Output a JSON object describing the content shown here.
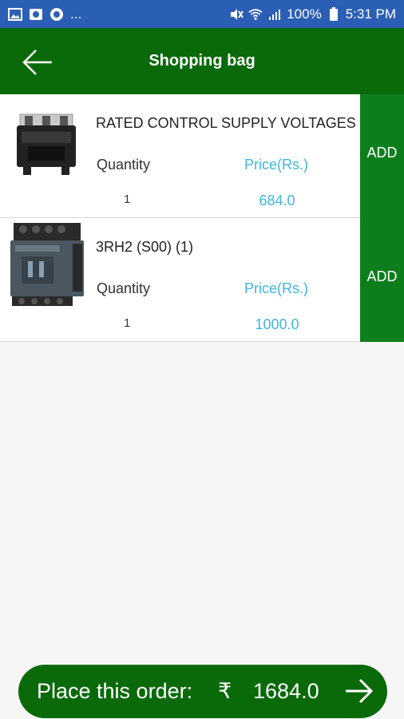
{
  "status_bar": {
    "left_ellipsis": "...",
    "battery": "100%",
    "time": "5:31 PM"
  },
  "app_bar": {
    "title": "Shopping bag"
  },
  "items": [
    {
      "name": "RATED CONTROL SUPPLY VOLTAGES",
      "quantity_label": "Quantity",
      "price_label": "Price(Rs.)",
      "quantity": "1",
      "price": "684.0",
      "add_label": "ADD"
    },
    {
      "name": "3RH2 (S00) (1)",
      "quantity_label": "Quantity",
      "price_label": "Price(Rs.)",
      "quantity": "1",
      "price": "1000.0",
      "add_label": "ADD"
    }
  ],
  "order": {
    "label": "Place this order:",
    "currency": "₹",
    "total": "1684.0"
  },
  "colors": {
    "status_bar": "#2b5fb5",
    "app_bar": "#0a6a0a",
    "add_button": "#0c7f1c",
    "price_text": "#3fb6e0"
  }
}
